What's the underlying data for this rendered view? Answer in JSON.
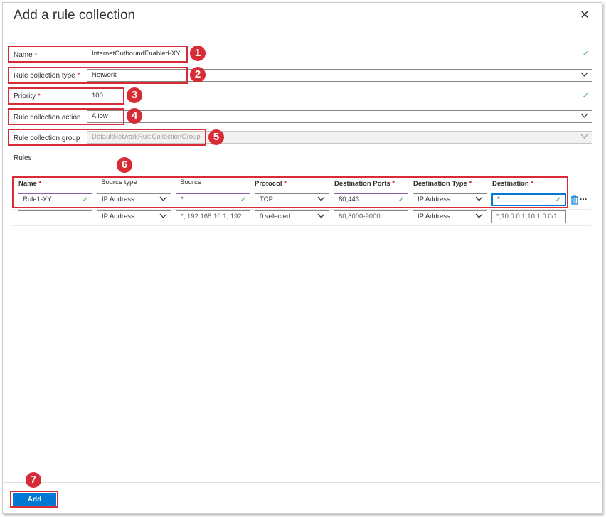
{
  "dialog": {
    "title": "Add a rule collection",
    "close_icon": "close-icon"
  },
  "form": {
    "name": {
      "label": "Name",
      "required": "*",
      "value": "InternetOutboundEnabled-XY"
    },
    "type": {
      "label": "Rule collection type",
      "required": "*",
      "value": "Network"
    },
    "priority": {
      "label": "Priority",
      "required": "*",
      "value": "100"
    },
    "action": {
      "label": "Rule collection action",
      "value": "Allow"
    },
    "group": {
      "label": "Rule collection group",
      "value": "DefaultNetworkRuleCollectionGroup"
    }
  },
  "rules": {
    "label": "Rules",
    "columns": {
      "name": "Name",
      "source_type": "Source type",
      "source": "Source",
      "protocol": "Protocol",
      "dest_ports": "Destination Ports",
      "dest_type": "Destination Type",
      "destination": "Destination"
    },
    "required": "*",
    "row1": {
      "name": "Rule1-XY",
      "source_type": "IP Address",
      "source": "*",
      "protocol": "TCP",
      "dest_ports": "80,443",
      "dest_type": "IP Address",
      "destination": "*"
    },
    "row2": {
      "name": "",
      "source_type": "IP Address",
      "source_placeholder": "*, 192.168.10.1, 192....",
      "protocol": "0 selected",
      "dest_ports_placeholder": "80,8000-9000",
      "dest_type": "IP Address",
      "destination_placeholder": "*,10.0.0.1,10.1.0.0/1..."
    }
  },
  "badges": [
    "1",
    "2",
    "3",
    "4",
    "5",
    "6",
    "7"
  ],
  "footer": {
    "add_label": "Add"
  },
  "colors": {
    "accent": "#0078d4",
    "highlight": "#d72b36",
    "valid": "#3aa04b"
  }
}
